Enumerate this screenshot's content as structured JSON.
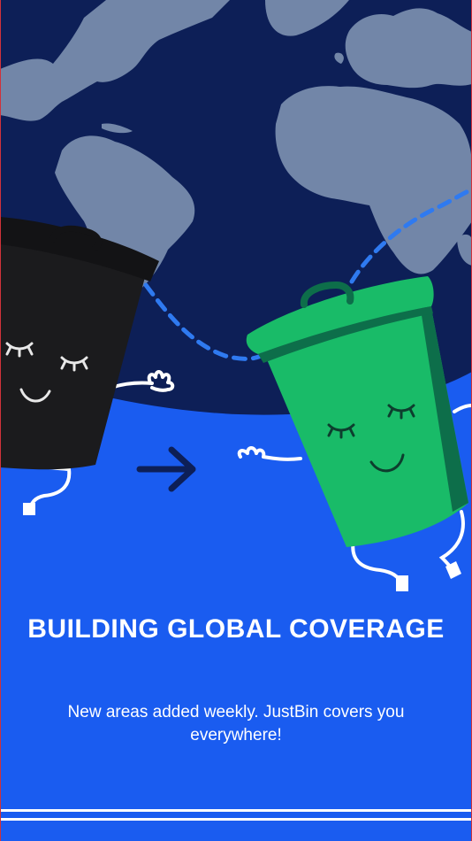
{
  "onboarding": {
    "title": "BUILDING GLOBAL COVERAGE",
    "subtitle": "New areas added weekly. JustBin covers you everywhere!"
  },
  "illustration": {
    "icons": [
      "world-map",
      "black-bin-character",
      "green-bin-character",
      "arrow-right-icon"
    ],
    "colors": {
      "ocean": "#0d1f57",
      "land": "#7286a8",
      "background": "#1a5cf0",
      "route": "#2f7af0",
      "black_bin": "#1b1b1d",
      "green_bin": "#19bb68",
      "green_bin_dark": "#0d6e4a"
    }
  }
}
